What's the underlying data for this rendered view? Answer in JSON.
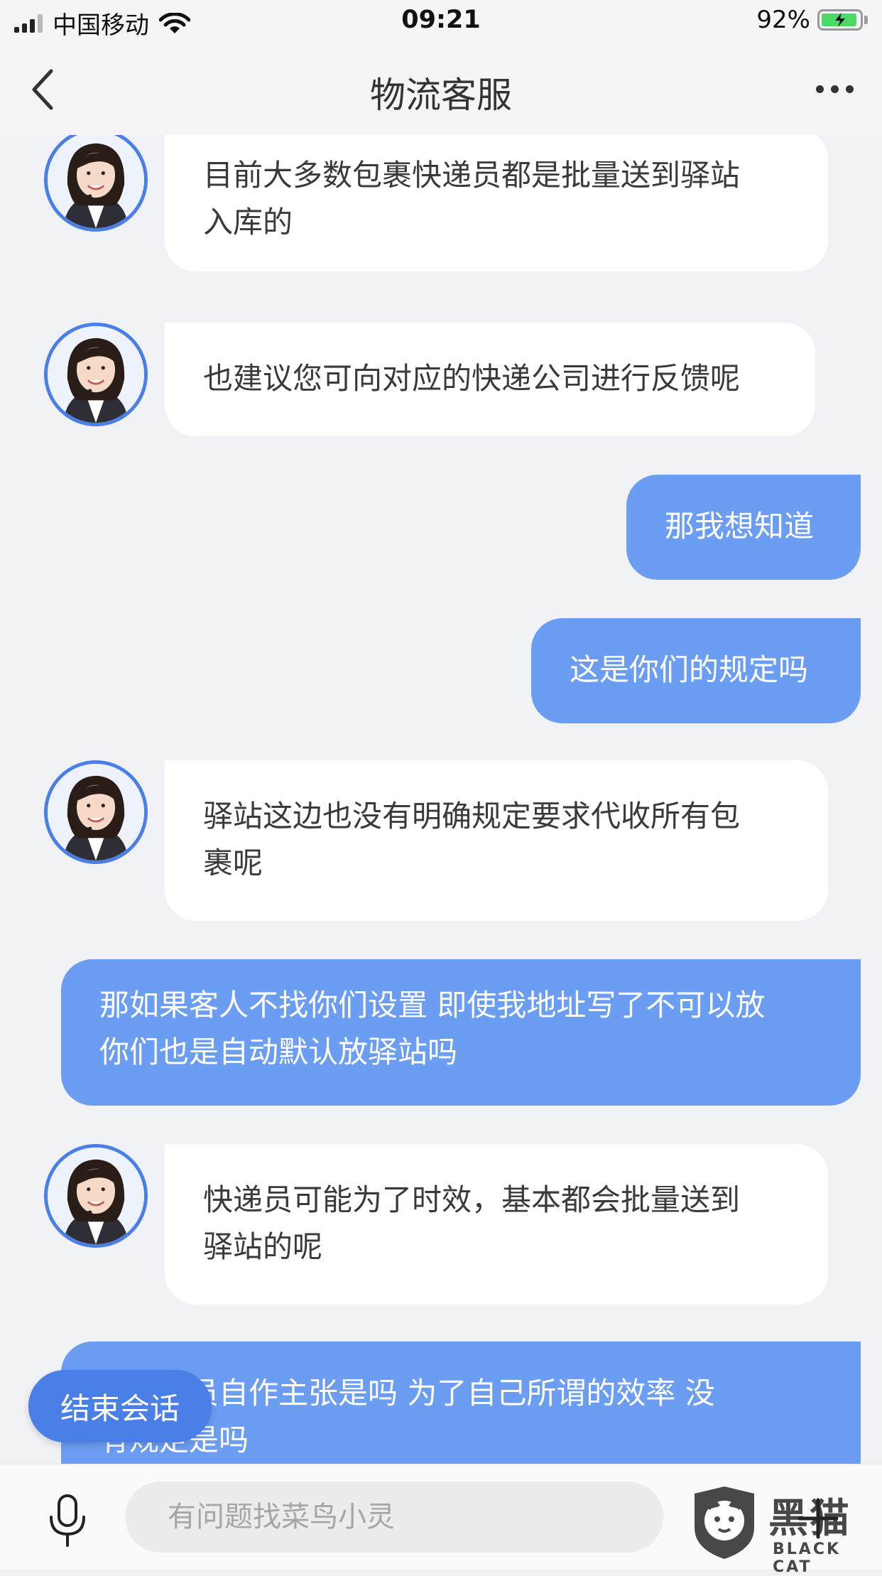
{
  "status_bar": {
    "carrier": "中国移动",
    "time": "09:21",
    "battery": "92%"
  },
  "header": {
    "title": "物流客服"
  },
  "messages": [
    {
      "from": "agent",
      "text": "目前大多数包裹快递员都是批量送到驿站\n入库的"
    },
    {
      "from": "agent",
      "text": "也建议您可向对应的快递公司进行反馈呢"
    },
    {
      "from": "user",
      "text": "那我想知道"
    },
    {
      "from": "user",
      "text": "这是你们的规定吗"
    },
    {
      "from": "agent",
      "text": "驿站这边也没有明确规定要求代收所有包\n裹呢"
    },
    {
      "from": "user",
      "text": "那如果客人不找你们设置 即使我地址写了不可以放\n你们也是自动默认放驿站吗"
    },
    {
      "from": "agent",
      "text": "快递员可能为了时效，基本都会批量送到\n驿站的呢"
    },
    {
      "from": "user",
      "text": "那快递员自作主张是吗 为了自己所谓的效率 没\n有规定是吗"
    }
  ],
  "end_chat_button": "结束会话",
  "input": {
    "placeholder": "有问题找菜鸟小灵",
    "value": ""
  },
  "watermark": {
    "cn": "黑猫",
    "en": "BLACK CAT"
  },
  "colors": {
    "accent": "#4a7fe8",
    "user_bubble": "#6b9df2",
    "agent_bubble": "#ffffff",
    "background": "#f1f2f6"
  }
}
